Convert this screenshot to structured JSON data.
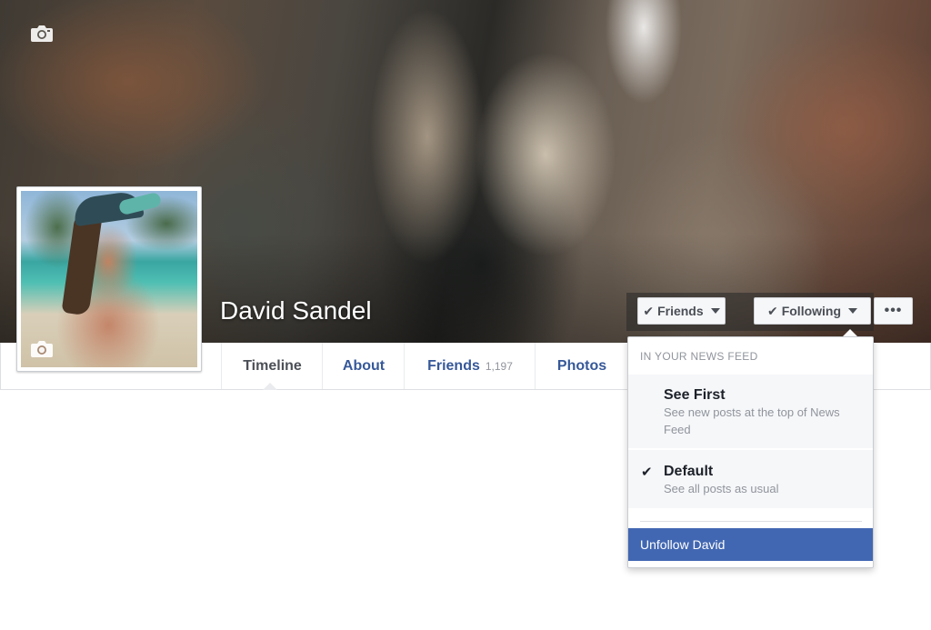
{
  "profile": {
    "name": "David Sandel"
  },
  "nav": {
    "tabs": [
      {
        "label": "Timeline",
        "active": true
      },
      {
        "label": "About"
      },
      {
        "label": "Friends",
        "count": "1,197"
      },
      {
        "label": "Photos"
      }
    ]
  },
  "actions": {
    "friends_label": "Friends",
    "following_label": "Following",
    "more_label": "•••"
  },
  "dropdown": {
    "header": "IN YOUR NEWS FEED",
    "options": [
      {
        "title": "See First",
        "description": "See new posts at the top of News Feed",
        "checked": false
      },
      {
        "title": "Default",
        "description": "See all posts as usual",
        "checked": true
      }
    ],
    "unfollow_label": "Unfollow David"
  },
  "icons": {
    "cover_camera": "camera-icon",
    "profile_camera": "camera-icon",
    "check": "checkmark-icon",
    "caret": "caret-down-icon"
  },
  "colors": {
    "link_blue": "#365899",
    "highlight_blue": "#4267b2",
    "text_dark": "#1d2129",
    "text_muted": "#90949c"
  }
}
